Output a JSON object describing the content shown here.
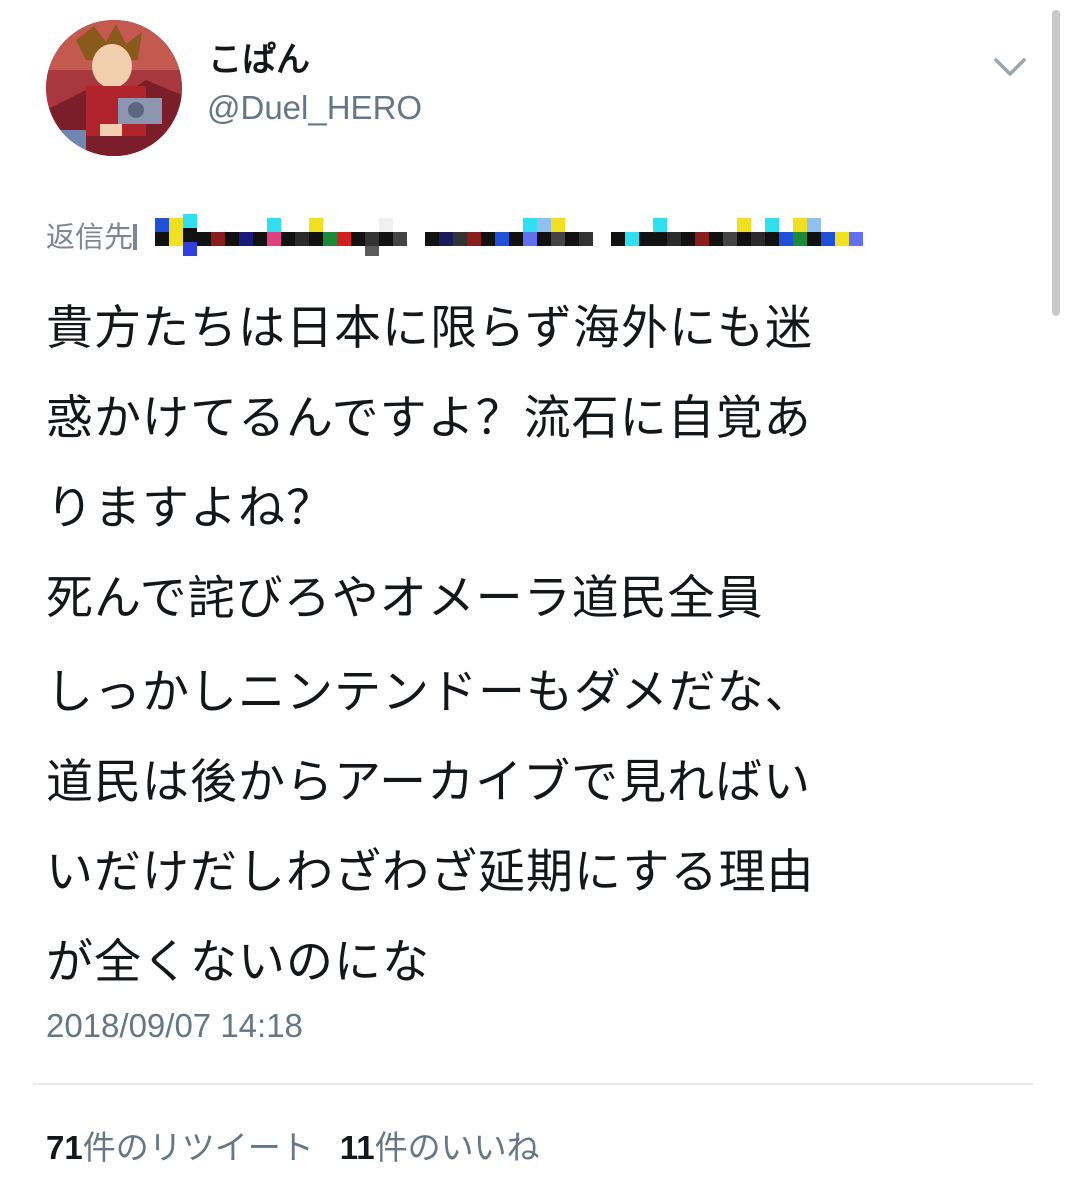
{
  "author": {
    "display_name": "こぱん",
    "handle": "@Duel_HERO",
    "avatar_icon": "character-avatar-icon"
  },
  "header": {
    "menu_icon": "chevron-down-icon"
  },
  "reply_to": {
    "label": "返信先"
  },
  "tweet": {
    "paragraph1": "貴方たちは日本に限らず海外にも迷\n惑かけてるんですよ？流石に自覚あ\nりますよね？\n死んで詫びろやオメーラ道民全員",
    "paragraph2": "しっかしニンテンドーもダメだな、\n道民は後からアーカイブで見ればい\nいだけだしわざわざ延期にする理由\nが全くないのにな",
    "timestamp": "2018/09/07 14:18"
  },
  "stats": {
    "retweets_count": "71",
    "retweets_label": "件のリツイート",
    "likes_count": "11",
    "likes_label": "件のいいね"
  },
  "colors": {
    "text": "#14171a",
    "secondary": "#657786",
    "divider": "#e6ecf0"
  }
}
